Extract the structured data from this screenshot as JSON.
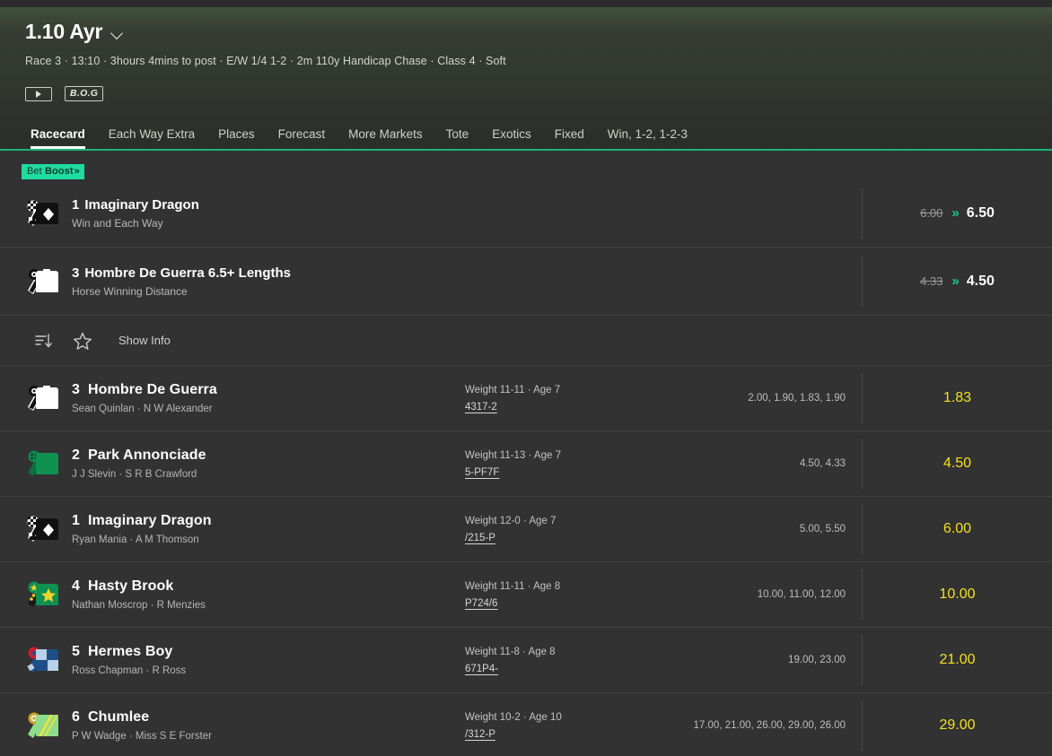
{
  "header": {
    "title": "1.10 Ayr",
    "dropdown_icon": "chevron-down-icon",
    "meta": "Race 3 · 13:10 · 3hours 4mins to post · E/W 1/4 1-2 · 2m 110y Handicap Chase · Class 4 · Soft",
    "play_icon": "play-icon",
    "bog_badge": "B.O.G",
    "accent_color": "#15b87a",
    "tabs": [
      {
        "label": "Racecard",
        "active": true
      },
      {
        "label": "Each Way Extra",
        "active": false
      },
      {
        "label": "Places",
        "active": false
      },
      {
        "label": "Forecast",
        "active": false
      },
      {
        "label": "More Markets",
        "active": false
      },
      {
        "label": "Tote",
        "active": false
      },
      {
        "label": "Exotics",
        "active": false
      },
      {
        "label": "Fixed",
        "active": false
      },
      {
        "label": "Win, 1-2, 1-2-3",
        "active": false
      }
    ]
  },
  "bet_boost": {
    "badge_prefix": "Bet ",
    "badge_strong": "Boost",
    "badge_arrows": "»",
    "badge_color": "#1fdba0",
    "rows": [
      {
        "number": "1",
        "name": "Imaginary Dragon",
        "market": "Win and Each Way",
        "old_odds": "6.00",
        "arrow": "»",
        "new_odds": "6.50",
        "silk": "checkered-black-diamond-silk"
      },
      {
        "number": "3",
        "name": "Hombre De Guerra 6.5+ Lengths",
        "market": "Horse Winning Distance",
        "old_odds": "4.33",
        "arrow": "»",
        "new_odds": "4.50",
        "silk": "white-silk"
      }
    ]
  },
  "toolbar": {
    "sort_icon": "sort-icon",
    "favourite_icon": "star-icon",
    "show_info_label": "Show Info"
  },
  "runners": {
    "price_color": "#f5e01e",
    "rows": [
      {
        "number": "3",
        "name": "Hombre De Guerra",
        "jockey_trainer": "Sean Quinlan · N W Alexander",
        "weight": "Weight 11-11 · Age 7",
        "form": "4317-2",
        "history": "2.00, 1.90, 1.83, 1.90",
        "price": "1.83",
        "silk": "white-silk"
      },
      {
        "number": "2",
        "name": "Park Annonciade",
        "jockey_trainer": "J J Slevin · S R B Crawford",
        "weight": "Weight 11-13 · Age 7",
        "form": "5-PF7F",
        "history": "4.50, 4.33",
        "price": "4.50",
        "silk": "green-silk"
      },
      {
        "number": "1",
        "name": "Imaginary Dragon",
        "jockey_trainer": "Ryan Mania · A M Thomson",
        "weight": "Weight 12-0 · Age 7",
        "form": "/215-P",
        "history": "5.00, 5.50",
        "price": "6.00",
        "silk": "checkered-black-diamond-silk"
      },
      {
        "number": "4",
        "name": "Hasty Brook",
        "jockey_trainer": "Nathan Moscrop · R Menzies",
        "weight": "Weight 11-11 · Age 8",
        "form": "P724/6",
        "history": "10.00, 11.00, 12.00",
        "price": "10.00",
        "silk": "green-star-silk"
      },
      {
        "number": "5",
        "name": "Hermes Boy",
        "jockey_trainer": "Ross Chapman · R Ross",
        "weight": "Weight 11-8 · Age 8",
        "form": "671P4-",
        "history": "19.00, 23.00",
        "price": "21.00",
        "silk": "blue-check-silk"
      },
      {
        "number": "6",
        "name": "Chumlee",
        "jockey_trainer": "P W Wadge · Miss S E Forster",
        "weight": "Weight 10-2 · Age 10",
        "form": "/312-P",
        "history": "17.00, 21.00, 26.00, 29.00, 26.00",
        "price": "29.00",
        "silk": "lightgreen-yellow-sash-silk"
      }
    ]
  }
}
